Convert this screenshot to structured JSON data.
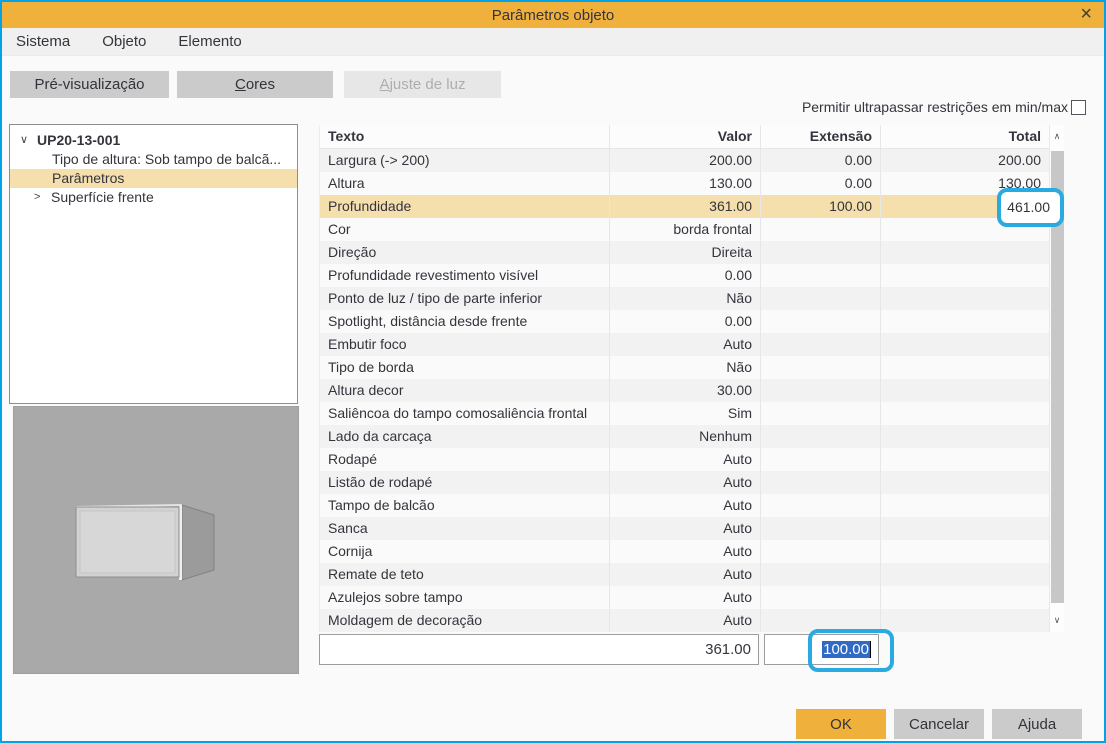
{
  "colors": {
    "accent_orange": "#F0B03C",
    "dialog_border_blue": "#00A3E8",
    "annotation_blue": "#29ABE2",
    "selection_blue": "#316AC5",
    "row_highlight_tan": "#F5DFAD"
  },
  "window": {
    "title": "Parâmetros objeto",
    "close_icon": "×"
  },
  "menu": {
    "items": [
      {
        "label": "Sistema"
      },
      {
        "label": "Objeto"
      },
      {
        "label": "Elemento"
      }
    ]
  },
  "tabs": [
    {
      "label": "Pré-visualização",
      "enabled": true,
      "underline": -1
    },
    {
      "label": "Cores",
      "enabled": true,
      "underline": 0
    },
    {
      "label": "Ajuste de luz",
      "enabled": false,
      "underline": 0
    }
  ],
  "options": {
    "checkbox_label": "Permitir ultrapassar restrições em min/max",
    "checked": false
  },
  "tree": {
    "items": [
      {
        "label": "UP20-13-001",
        "level": 0,
        "state": "expanded",
        "bold": true,
        "selected": false
      },
      {
        "label": "Tipo de altura: Sob tampo de balcã...",
        "level": 1,
        "state": "leaf",
        "bold": false,
        "selected": false
      },
      {
        "label": "Parâmetros",
        "level": 1,
        "state": "leaf",
        "bold": false,
        "selected": true
      },
      {
        "label": "Superfície frente",
        "level": 1,
        "state": "collapsed",
        "bold": false,
        "selected": false
      }
    ]
  },
  "table": {
    "columns": [
      "Texto",
      "Valor",
      "Extensão",
      "Total"
    ],
    "rows": [
      {
        "texto": "Largura (-> 200)",
        "valor": "200.00",
        "extensao": "0.00",
        "total": "200.00"
      },
      {
        "texto": "Altura",
        "valor": "130.00",
        "extensao": "0.00",
        "total": "130.00"
      },
      {
        "texto": "Profundidade",
        "valor": "361.00",
        "extensao": "100.00",
        "total": "461.00",
        "highlighted": true
      },
      {
        "texto": "Cor",
        "valor": "borda frontal",
        "extensao": "",
        "total": ""
      },
      {
        "texto": "Direção",
        "valor": "Direita",
        "extensao": "",
        "total": ""
      },
      {
        "texto": "Profundidade revestimento visível",
        "valor": "0.00",
        "extensao": "",
        "total": ""
      },
      {
        "texto": "Ponto de luz / tipo de parte inferior",
        "valor": "Não",
        "extensao": "",
        "total": ""
      },
      {
        "texto": "Spotlight, distância desde frente",
        "valor": "0.00",
        "extensao": "",
        "total": ""
      },
      {
        "texto": "Embutir foco",
        "valor": "Auto",
        "extensao": "",
        "total": ""
      },
      {
        "texto": "Tipo de borda",
        "valor": "Não",
        "extensao": "",
        "total": ""
      },
      {
        "texto": "Altura decor",
        "valor": "30.00",
        "extensao": "",
        "total": ""
      },
      {
        "texto": "Saliêncoa do tampo comosaliência frontal",
        "valor": "Sim",
        "extensao": "",
        "total": ""
      },
      {
        "texto": "Lado da carcaça",
        "valor": "Nenhum",
        "extensao": "",
        "total": ""
      },
      {
        "texto": "Rodapé",
        "valor": "Auto",
        "extensao": "",
        "total": ""
      },
      {
        "texto": "Listão de rodapé",
        "valor": "Auto",
        "extensao": "",
        "total": ""
      },
      {
        "texto": "Tampo de balcão",
        "valor": "Auto",
        "extensao": "",
        "total": ""
      },
      {
        "texto": "Sanca",
        "valor": "Auto",
        "extensao": "",
        "total": ""
      },
      {
        "texto": "Cornija",
        "valor": "Auto",
        "extensao": "",
        "total": ""
      },
      {
        "texto": "Remate de teto",
        "valor": "Auto",
        "extensao": "",
        "total": ""
      },
      {
        "texto": "Azulejos sobre tampo",
        "valor": "Auto",
        "extensao": "",
        "total": ""
      },
      {
        "texto": "Moldagem de decoração",
        "valor": "Auto",
        "extensao": "",
        "total": ""
      }
    ]
  },
  "footer": {
    "value_field": "361.00",
    "extension_field": "100.00",
    "extension_selected": true
  },
  "buttons": {
    "ok": "OK",
    "cancel": "Cancelar",
    "help": "Ajuda"
  }
}
